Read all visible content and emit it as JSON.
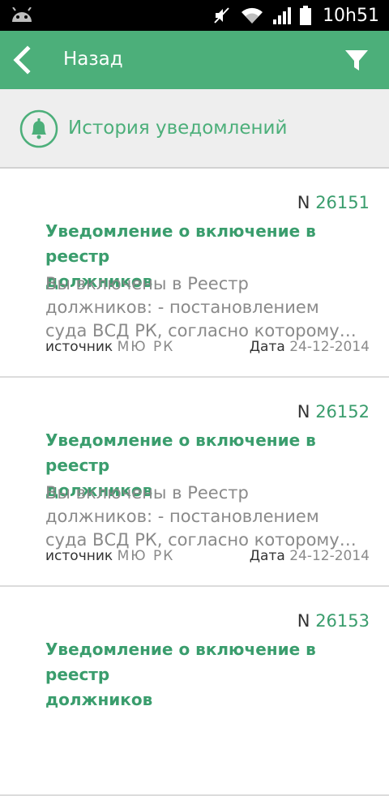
{
  "statusbar": {
    "time": "10h51"
  },
  "appbar": {
    "back_label": "Назад"
  },
  "section": {
    "title": "История уведомлений"
  },
  "notifications": [
    {
      "number_prefix": "N",
      "number": "26151",
      "title_line1": "Уведомление о включение в реестр",
      "title_line2": "должников",
      "body_line1": "Вы включены в Реестр",
      "body_line2": "должников: - постановлением",
      "body_line3": "суда ВСД РК, согласно которому…",
      "source_label": "источник",
      "source_value": "МЮ РК",
      "date_label": "Дата",
      "date_value": "24-12-2014"
    },
    {
      "number_prefix": "N",
      "number": "26152",
      "title_line1": "Уведомление о включение в реестр",
      "title_line2": "должников",
      "body_line1": "Вы включены в Реестр",
      "body_line2": "должников: - постановлением",
      "body_line3": "суда ВСД РК, согласно которому…",
      "source_label": "источник",
      "source_value": "МЮ РК",
      "date_label": "Дата",
      "date_value": "24-12-2014"
    },
    {
      "number_prefix": "N",
      "number": "26153",
      "title_line1": "Уведомление о включение в реестр",
      "title_line2": "должников",
      "body_line1": "",
      "body_line2": "",
      "body_line3": "",
      "source_label": "",
      "source_value": "",
      "date_label": "",
      "date_value": ""
    }
  ],
  "colors": {
    "accent": "#4caf7a",
    "accent_text": "#3a9d6d",
    "statusbar": "#000000"
  }
}
